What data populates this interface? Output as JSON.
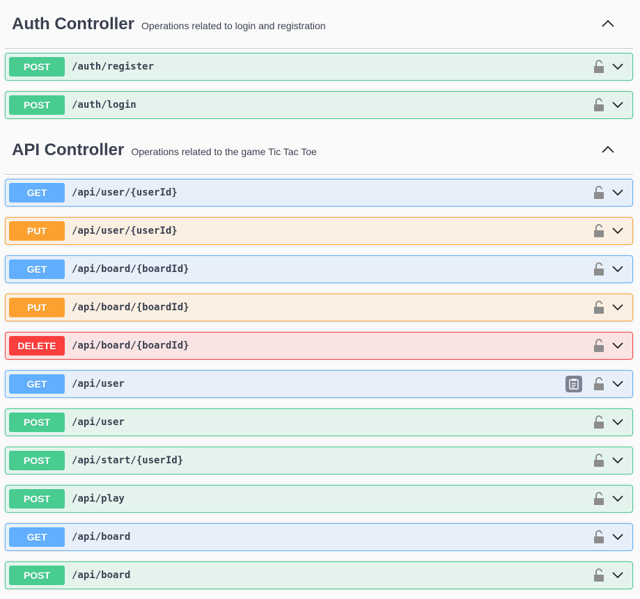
{
  "sections": [
    {
      "title": "Auth Controller",
      "description": "Operations related to login and registration",
      "operations": [
        {
          "method": "POST",
          "path": "/auth/register"
        },
        {
          "method": "POST",
          "path": "/auth/login"
        }
      ]
    },
    {
      "title": "API Controller",
      "description": "Operations related to the game Tic Tac Toe",
      "operations": [
        {
          "method": "GET",
          "path": "/api/user/{userId}"
        },
        {
          "method": "PUT",
          "path": "/api/user/{userId}"
        },
        {
          "method": "GET",
          "path": "/api/board/{boardId}"
        },
        {
          "method": "PUT",
          "path": "/api/board/{boardId}"
        },
        {
          "method": "DELETE",
          "path": "/api/board/{boardId}"
        },
        {
          "method": "GET",
          "path": "/api/user"
        },
        {
          "method": "POST",
          "path": "/api/user"
        },
        {
          "method": "POST",
          "path": "/api/start/{userId}"
        },
        {
          "method": "POST",
          "path": "/api/play"
        },
        {
          "method": "GET",
          "path": "/api/board"
        },
        {
          "method": "POST",
          "path": "/api/board"
        }
      ]
    }
  ],
  "colors": {
    "post": "#49cc90",
    "get": "#61affe",
    "put": "#fca130",
    "delete": "#f93e3e"
  },
  "icons": {
    "lock": "unlocked-padlock-icon",
    "expand": "chevron-down-icon",
    "collapse": "chevron-up-icon",
    "copy": "clipboard-icon"
  }
}
